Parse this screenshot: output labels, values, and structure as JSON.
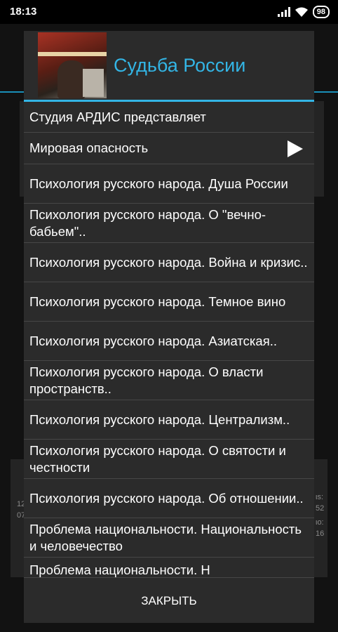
{
  "status_bar": {
    "time": "18:13",
    "battery": "98"
  },
  "background": {
    "left_numbers": [
      "12",
      "07"
    ],
    "right_numbers": [
      "ιs:",
      "52",
      "ιo:",
      "16"
    ]
  },
  "dialog": {
    "title": "Судьба России",
    "items": [
      {
        "label": "Студия АРДИС представляет"
      },
      {
        "label": "Мировая опасность",
        "playing": true
      },
      {
        "label": "Психология русского народа. Душа России"
      },
      {
        "label": "Психология русского народа. О \"вечно-бабьем\".."
      },
      {
        "label": "Психология русского народа. Война и кризис.."
      },
      {
        "label": "Психология русского народа. Темное вино"
      },
      {
        "label": "Психология русского народа. Азиатская.."
      },
      {
        "label": "Психология русского народа. О власти пространств.."
      },
      {
        "label": "Психология русского народа. Централизм.."
      },
      {
        "label": "Психология русского народа. О святости и честности"
      },
      {
        "label": "Психология русского народа. Об отношении.."
      },
      {
        "label": "Проблема национальности. Национальность и человечество"
      },
      {
        "label": "Проблема национальности. Н"
      }
    ],
    "close_label": "ЗАКРЫТЬ"
  }
}
